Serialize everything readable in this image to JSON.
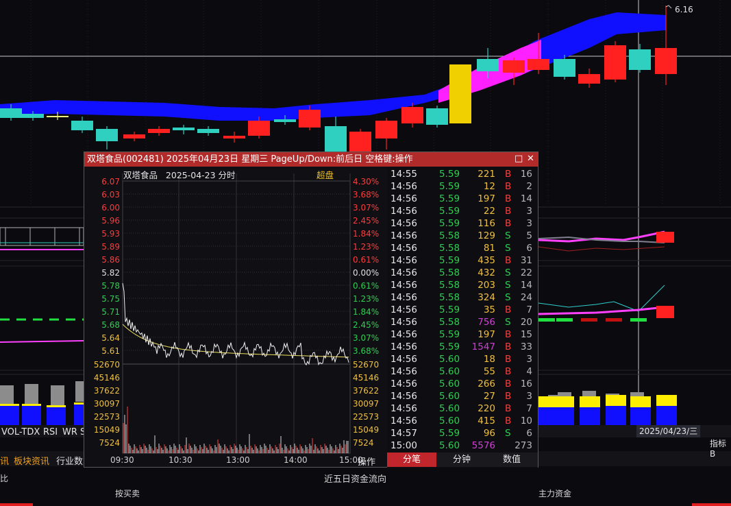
{
  "main_chart": {
    "top_price_label": "6.16",
    "date_label": "2025/04/23/三",
    "right_tab": "指标B"
  },
  "indicator_tabs": [
    "VOL-TDX",
    "RSI",
    "WR",
    "S"
  ],
  "lower_tabs": [
    "讯",
    "板块资讯",
    "行业数"
  ],
  "bottom_texts": {
    "left_fragment": "比",
    "center_title": "近五日资金流向",
    "buy_sell": "按买卖",
    "main_funds": "主力资金"
  },
  "popup": {
    "title": "双塔食品(002481) 2025年04月23日 星期三 PageUp/Down:前后日 空格键:操作",
    "restore_icon": "□",
    "close_icon": "✕",
    "chart_header": "双塔食品   2025-04-23 分时",
    "chart_badge": "超盘",
    "price_labels": [
      "6.07",
      "6.03",
      "6.00",
      "5.96",
      "5.93",
      "5.89",
      "5.86",
      "5.82",
      "5.78",
      "5.75",
      "5.71",
      "5.68",
      "5.64",
      "5.61"
    ],
    "pct_labels": [
      "4.30%",
      "3.68%",
      "3.07%",
      "2.45%",
      "1.84%",
      "1.23%",
      "0.61%",
      "0.00%",
      "0.61%",
      "1.23%",
      "1.84%",
      "2.45%",
      "3.07%",
      "3.68%"
    ],
    "vol_labels": [
      "52670",
      "45146",
      "37622",
      "30097",
      "22573",
      "15049",
      "7524"
    ],
    "time_labels": [
      "09:30",
      "10:30",
      "13:00",
      "14:00",
      "15:00"
    ],
    "op_label": "操作",
    "tabs": [
      "分笔",
      "分钟",
      "数值"
    ]
  },
  "ticks": [
    {
      "time": "14:55",
      "price": "5.59",
      "vol": "221",
      "bs": "B",
      "n": "16"
    },
    {
      "time": "14:56",
      "price": "5.59",
      "vol": "12",
      "bs": "B",
      "n": "2"
    },
    {
      "time": "14:56",
      "price": "5.59",
      "vol": "197",
      "bs": "B",
      "n": "14"
    },
    {
      "time": "14:56",
      "price": "5.59",
      "vol": "22",
      "bs": "B",
      "n": "3"
    },
    {
      "time": "14:56",
      "price": "5.59",
      "vol": "116",
      "bs": "B",
      "n": "3"
    },
    {
      "time": "14:56",
      "price": "5.58",
      "vol": "129",
      "bs": "S",
      "n": "5"
    },
    {
      "time": "14:56",
      "price": "5.58",
      "vol": "81",
      "bs": "S",
      "n": "6"
    },
    {
      "time": "14:56",
      "price": "5.59",
      "vol": "435",
      "bs": "B",
      "n": "31"
    },
    {
      "time": "14:56",
      "price": "5.58",
      "vol": "432",
      "bs": "S",
      "n": "22"
    },
    {
      "time": "14:56",
      "price": "5.58",
      "vol": "203",
      "bs": "S",
      "n": "14"
    },
    {
      "time": "14:56",
      "price": "5.58",
      "vol": "324",
      "bs": "S",
      "n": "24"
    },
    {
      "time": "14:56",
      "price": "5.59",
      "vol": "35",
      "bs": "B",
      "n": "7"
    },
    {
      "time": "14:56",
      "price": "5.58",
      "vol": "756",
      "bs": "S",
      "n": "20"
    },
    {
      "time": "14:56",
      "price": "5.59",
      "vol": "197",
      "bs": "B",
      "n": "15"
    },
    {
      "time": "14:56",
      "price": "5.59",
      "vol": "1547",
      "bs": "B",
      "n": "33"
    },
    {
      "time": "14:56",
      "price": "5.60",
      "vol": "18",
      "bs": "B",
      "n": "3"
    },
    {
      "time": "14:56",
      "price": "5.60",
      "vol": "55",
      "bs": "B",
      "n": "4"
    },
    {
      "time": "14:56",
      "price": "5.60",
      "vol": "266",
      "bs": "B",
      "n": "16"
    },
    {
      "time": "14:56",
      "price": "5.60",
      "vol": "27",
      "bs": "B",
      "n": "3"
    },
    {
      "time": "14:56",
      "price": "5.60",
      "vol": "220",
      "bs": "B",
      "n": "7"
    },
    {
      "time": "14:56",
      "price": "5.60",
      "vol": "415",
      "bs": "B",
      "n": "10"
    },
    {
      "time": "14:57",
      "price": "5.59",
      "vol": "96",
      "bs": "S",
      "n": "6"
    },
    {
      "time": "15:00",
      "price": "5.60",
      "vol": "5576",
      "bs": "",
      "n": "273"
    }
  ],
  "colors": {
    "up": "#ff2020",
    "down": "#2fd0c0",
    "band": "#1010ff",
    "band_hot": "#ff20ff",
    "title_bar": "#b22b2b"
  }
}
